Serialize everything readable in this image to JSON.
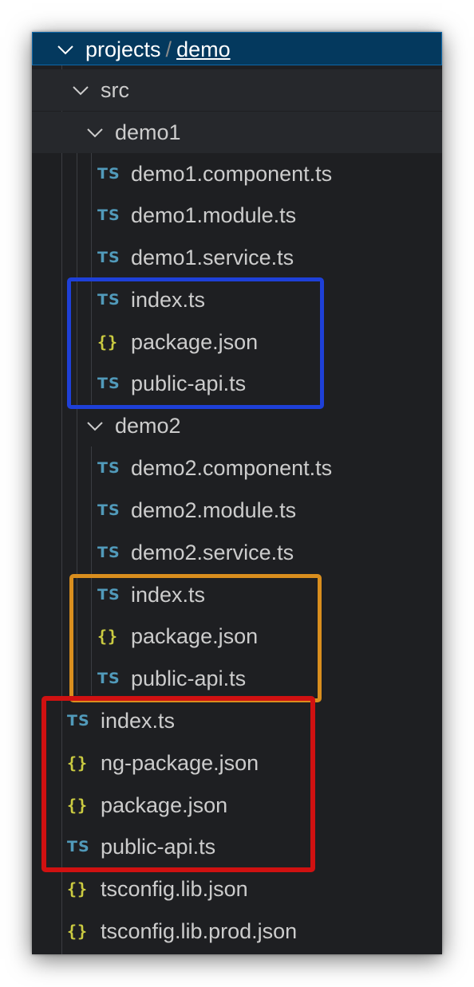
{
  "explorer": {
    "breadcrumb": {
      "parent": "projects",
      "separator": "/",
      "current": "demo"
    },
    "folders": {
      "src": "src",
      "demo1": "demo1",
      "demo2": "demo2"
    },
    "demo1_files": [
      {
        "icon": "TS",
        "label": "demo1.component.ts"
      },
      {
        "icon": "TS",
        "label": "demo1.module.ts"
      },
      {
        "icon": "TS",
        "label": "demo1.service.ts"
      },
      {
        "icon": "TS",
        "label": "index.ts"
      },
      {
        "icon": "{}",
        "label": "package.json"
      },
      {
        "icon": "TS",
        "label": "public-api.ts"
      }
    ],
    "demo2_files": [
      {
        "icon": "TS",
        "label": "demo2.component.ts"
      },
      {
        "icon": "TS",
        "label": "demo2.module.ts"
      },
      {
        "icon": "TS",
        "label": "demo2.service.ts"
      },
      {
        "icon": "TS",
        "label": "index.ts"
      },
      {
        "icon": "{}",
        "label": "package.json"
      },
      {
        "icon": "TS",
        "label": "public-api.ts"
      }
    ],
    "src_files": [
      {
        "icon": "TS",
        "label": "index.ts"
      },
      {
        "icon": "{}",
        "label": "ng-package.json"
      },
      {
        "icon": "{}",
        "label": "package.json"
      },
      {
        "icon": "TS",
        "label": "public-api.ts"
      }
    ],
    "root_files": [
      {
        "icon": "{}",
        "label": "tsconfig.lib.json"
      },
      {
        "icon": "{}",
        "label": "tsconfig.lib.prod.json"
      }
    ]
  },
  "colors": {
    "background": "#1e1f22",
    "header_background": "#04395e",
    "ts_icon": "#519aba",
    "json_icon": "#cbcb41",
    "box_blue": "#1e40d8",
    "box_orange": "#d98e1e",
    "box_red": "#d01111"
  },
  "icons": {
    "ts": "typescript-icon",
    "json": "json-icon",
    "chevron": "chevron-down-icon"
  }
}
